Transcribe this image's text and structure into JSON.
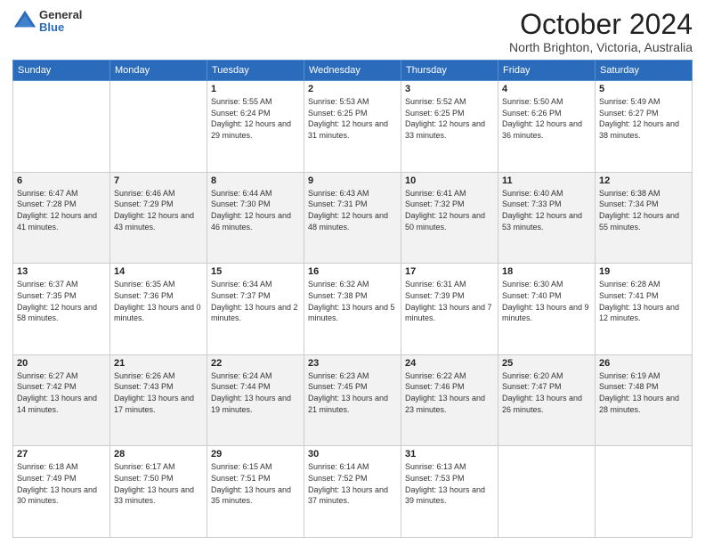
{
  "logo": {
    "general": "General",
    "blue": "Blue"
  },
  "title": {
    "month": "October 2024",
    "location": "North Brighton, Victoria, Australia"
  },
  "days_of_week": [
    "Sunday",
    "Monday",
    "Tuesday",
    "Wednesday",
    "Thursday",
    "Friday",
    "Saturday"
  ],
  "weeks": [
    [
      {
        "day": "",
        "info": ""
      },
      {
        "day": "",
        "info": ""
      },
      {
        "day": "1",
        "info": "Sunrise: 5:55 AM\nSunset: 6:24 PM\nDaylight: 12 hours and 29 minutes."
      },
      {
        "day": "2",
        "info": "Sunrise: 5:53 AM\nSunset: 6:25 PM\nDaylight: 12 hours and 31 minutes."
      },
      {
        "day": "3",
        "info": "Sunrise: 5:52 AM\nSunset: 6:25 PM\nDaylight: 12 hours and 33 minutes."
      },
      {
        "day": "4",
        "info": "Sunrise: 5:50 AM\nSunset: 6:26 PM\nDaylight: 12 hours and 36 minutes."
      },
      {
        "day": "5",
        "info": "Sunrise: 5:49 AM\nSunset: 6:27 PM\nDaylight: 12 hours and 38 minutes."
      }
    ],
    [
      {
        "day": "6",
        "info": "Sunrise: 6:47 AM\nSunset: 7:28 PM\nDaylight: 12 hours and 41 minutes."
      },
      {
        "day": "7",
        "info": "Sunrise: 6:46 AM\nSunset: 7:29 PM\nDaylight: 12 hours and 43 minutes."
      },
      {
        "day": "8",
        "info": "Sunrise: 6:44 AM\nSunset: 7:30 PM\nDaylight: 12 hours and 46 minutes."
      },
      {
        "day": "9",
        "info": "Sunrise: 6:43 AM\nSunset: 7:31 PM\nDaylight: 12 hours and 48 minutes."
      },
      {
        "day": "10",
        "info": "Sunrise: 6:41 AM\nSunset: 7:32 PM\nDaylight: 12 hours and 50 minutes."
      },
      {
        "day": "11",
        "info": "Sunrise: 6:40 AM\nSunset: 7:33 PM\nDaylight: 12 hours and 53 minutes."
      },
      {
        "day": "12",
        "info": "Sunrise: 6:38 AM\nSunset: 7:34 PM\nDaylight: 12 hours and 55 minutes."
      }
    ],
    [
      {
        "day": "13",
        "info": "Sunrise: 6:37 AM\nSunset: 7:35 PM\nDaylight: 12 hours and 58 minutes."
      },
      {
        "day": "14",
        "info": "Sunrise: 6:35 AM\nSunset: 7:36 PM\nDaylight: 13 hours and 0 minutes."
      },
      {
        "day": "15",
        "info": "Sunrise: 6:34 AM\nSunset: 7:37 PM\nDaylight: 13 hours and 2 minutes."
      },
      {
        "day": "16",
        "info": "Sunrise: 6:32 AM\nSunset: 7:38 PM\nDaylight: 13 hours and 5 minutes."
      },
      {
        "day": "17",
        "info": "Sunrise: 6:31 AM\nSunset: 7:39 PM\nDaylight: 13 hours and 7 minutes."
      },
      {
        "day": "18",
        "info": "Sunrise: 6:30 AM\nSunset: 7:40 PM\nDaylight: 13 hours and 9 minutes."
      },
      {
        "day": "19",
        "info": "Sunrise: 6:28 AM\nSunset: 7:41 PM\nDaylight: 13 hours and 12 minutes."
      }
    ],
    [
      {
        "day": "20",
        "info": "Sunrise: 6:27 AM\nSunset: 7:42 PM\nDaylight: 13 hours and 14 minutes."
      },
      {
        "day": "21",
        "info": "Sunrise: 6:26 AM\nSunset: 7:43 PM\nDaylight: 13 hours and 17 minutes."
      },
      {
        "day": "22",
        "info": "Sunrise: 6:24 AM\nSunset: 7:44 PM\nDaylight: 13 hours and 19 minutes."
      },
      {
        "day": "23",
        "info": "Sunrise: 6:23 AM\nSunset: 7:45 PM\nDaylight: 13 hours and 21 minutes."
      },
      {
        "day": "24",
        "info": "Sunrise: 6:22 AM\nSunset: 7:46 PM\nDaylight: 13 hours and 23 minutes."
      },
      {
        "day": "25",
        "info": "Sunrise: 6:20 AM\nSunset: 7:47 PM\nDaylight: 13 hours and 26 minutes."
      },
      {
        "day": "26",
        "info": "Sunrise: 6:19 AM\nSunset: 7:48 PM\nDaylight: 13 hours and 28 minutes."
      }
    ],
    [
      {
        "day": "27",
        "info": "Sunrise: 6:18 AM\nSunset: 7:49 PM\nDaylight: 13 hours and 30 minutes."
      },
      {
        "day": "28",
        "info": "Sunrise: 6:17 AM\nSunset: 7:50 PM\nDaylight: 13 hours and 33 minutes."
      },
      {
        "day": "29",
        "info": "Sunrise: 6:15 AM\nSunset: 7:51 PM\nDaylight: 13 hours and 35 minutes."
      },
      {
        "day": "30",
        "info": "Sunrise: 6:14 AM\nSunset: 7:52 PM\nDaylight: 13 hours and 37 minutes."
      },
      {
        "day": "31",
        "info": "Sunrise: 6:13 AM\nSunset: 7:53 PM\nDaylight: 13 hours and 39 minutes."
      },
      {
        "day": "",
        "info": ""
      },
      {
        "day": "",
        "info": ""
      }
    ]
  ]
}
